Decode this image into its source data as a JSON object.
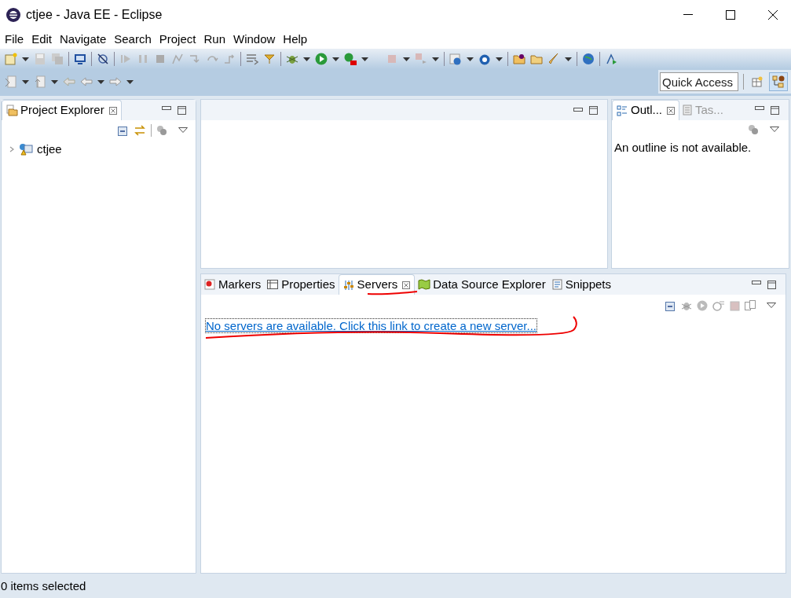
{
  "window": {
    "title": "ctjee - Java EE - Eclipse"
  },
  "menu": [
    "File",
    "Edit",
    "Navigate",
    "Search",
    "Project",
    "Run",
    "Window",
    "Help"
  ],
  "quick_access": {
    "placeholder": "Quick Access"
  },
  "project_explorer": {
    "tabs": [
      {
        "label": "Project Explorer",
        "selected": true
      }
    ],
    "tree": [
      {
        "label": "ctjee",
        "expanded": false
      }
    ]
  },
  "outline": {
    "tabs": [
      {
        "label": "Outl...",
        "selected": true
      },
      {
        "label": "Tas...",
        "selected": false
      }
    ],
    "message": "An outline is not available."
  },
  "bottom_panel": {
    "tabs": [
      {
        "label": "Markers",
        "selected": false
      },
      {
        "label": "Properties",
        "selected": false
      },
      {
        "label": "Servers",
        "selected": true
      },
      {
        "label": "Data Source Explorer",
        "selected": false
      },
      {
        "label": "Snippets",
        "selected": false
      }
    ],
    "link": "No servers are available. Click this link to create a new server..."
  },
  "status_bar": {
    "text": "0 items selected"
  }
}
